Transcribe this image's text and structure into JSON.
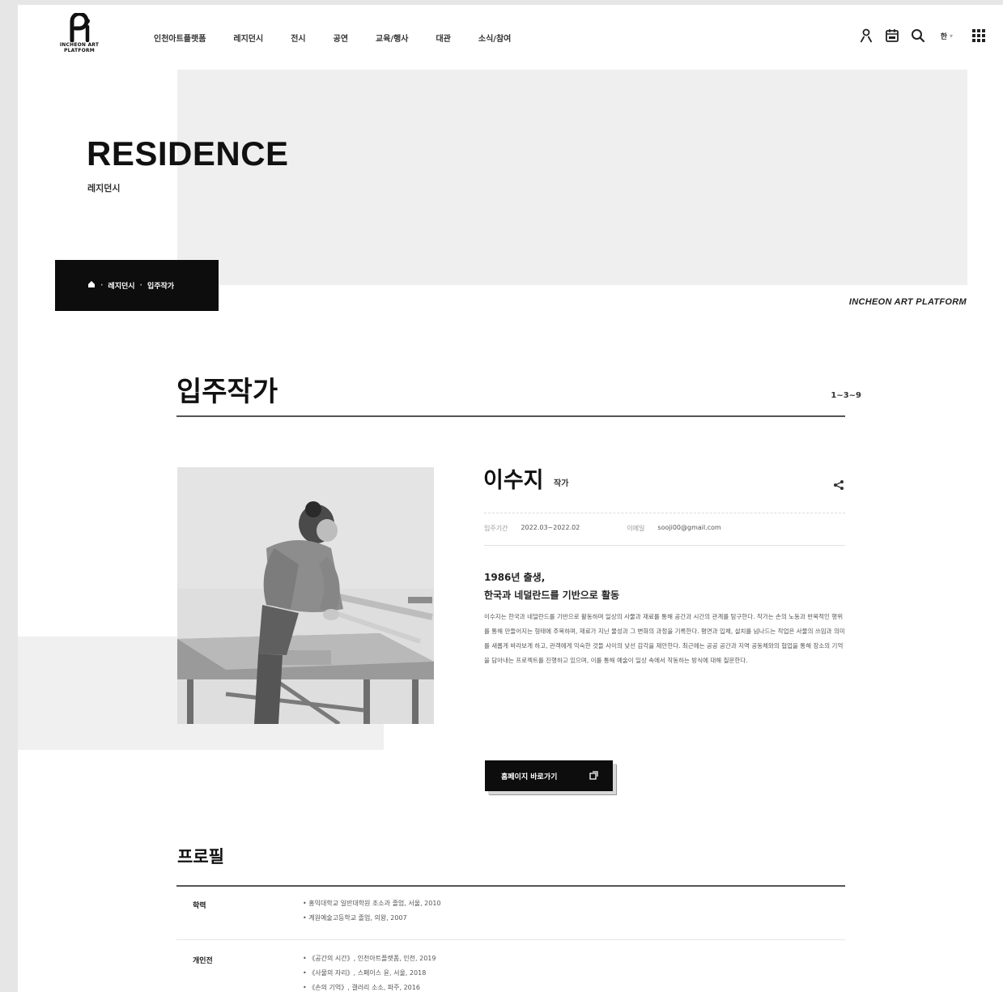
{
  "header": {
    "logo_text": "INCHEON ART PLATFORM",
    "nav": [
      "인천아트플랫폼",
      "레지던시",
      "전시",
      "공연",
      "교육/행사",
      "대관",
      "소식/참여"
    ],
    "lang_label": "한",
    "icons": [
      "user-icon",
      "calendar-icon",
      "search-icon",
      "grid-menu-icon"
    ]
  },
  "hero": {
    "title": "RESIDENCE",
    "subtitle": "레지던시",
    "breadcrumb": [
      "레지던시",
      "입주작가"
    ],
    "brand_tag": "INCHEON ART PLATFORM"
  },
  "section": {
    "title": "입주작가",
    "right_label": "1~3~9"
  },
  "artist": {
    "name": "이수지",
    "role": "작가",
    "meta": [
      {
        "key": "입주기간",
        "value": "2022.03~2022.02"
      },
      {
        "key": "이메일",
        "value": "sooji00@gmail.com"
      }
    ],
    "intro_line1": "1986년 출생,",
    "intro_line2": "한국과 네덜란드를 기반으로 활동",
    "bio": "이수지는 한국과 네덜란드를 기반으로 활동하며 일상의 사물과 재료를 통해 공간과 시간의 관계를 탐구한다. 작가는 손의 노동과 반복적인 행위를 통해 만들어지는 형태에 주목하며, 재료가 지닌 물성과 그 변화의 과정을 기록한다. 평면과 입체, 설치를 넘나드는 작업은 사물의 쓰임과 의미를 새롭게 바라보게 하고, 관객에게 익숙한 것들 사이의 낯선 감각을 제안한다. 최근에는 공공 공간과 지역 공동체와의 협업을 통해 장소의 기억을 담아내는 프로젝트를 진행하고 있으며, 이를 통해 예술이 일상 속에서 작동하는 방식에 대해 질문한다.",
    "site_button": "홈페이지 바로가기"
  },
  "profile": {
    "title": "프로필",
    "rows": [
      {
        "key": "학력",
        "items": [
          "• 홍익대학교 일반대학원 조소과 졸업, 서울, 2010",
          "• 계원예술고등학교 졸업, 의왕, 2007"
        ]
      },
      {
        "key": "개인전",
        "items": [
          "• 《공간의 시간》, 인천아트플랫폼, 인천, 2019",
          "• 《사물의 자리》, 스페이스 윤, 서울, 2018",
          "• 《손의 기억》, 갤러리 소소, 파주, 2016"
        ]
      }
    ]
  }
}
